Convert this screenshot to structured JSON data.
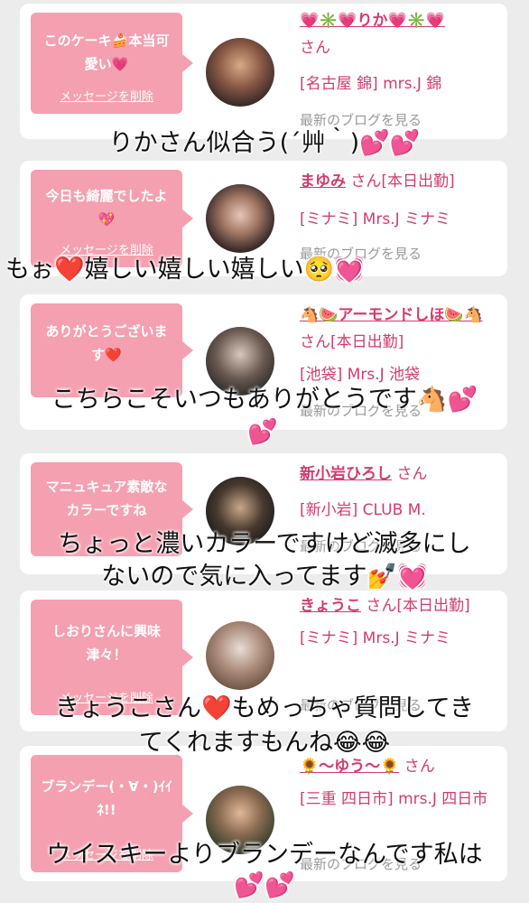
{
  "cards": [
    {
      "message": "このケーキ🍰本当可愛い💗",
      "delete_label": "メッセージを削除",
      "name": "💗✳️💗りか💗✳️💗",
      "san": "さん",
      "location": "[名古屋 錦] mrs.J 錦",
      "blog": "最新のブログを見る"
    },
    {
      "message": "今日も綺麗でしたよ💖",
      "delete_label": "メッセージを削除",
      "name": "まゆみ",
      "san": "さん[本日出勤]",
      "location": "[ミナミ] Mrs.J ミナミ",
      "blog": "最新のブログを見る"
    },
    {
      "message": "ありがとうございます❤️",
      "delete_label": "メッセージを削除",
      "name": "🐴🍉アーモンドしほ🍉🐴",
      "san": "さん[本日出勤]",
      "location": "[池袋] Mrs.J 池袋",
      "blog": "最新のブログを見る"
    },
    {
      "message": "マニュキュア素敵なカラーですね",
      "delete_label": "メッセージを削除",
      "name": "新小岩ひろし",
      "san": "さん",
      "location": "[新小岩] CLUB M.",
      "blog": "最新のブログを見る"
    },
    {
      "message": "しおりさんに興味津々！",
      "delete_label": "メッセージを削除",
      "name": "きょうこ",
      "san": "さん[本日出勤]",
      "location": "[ミナミ] Mrs.J ミナミ",
      "blog": "最新のブログを見る"
    },
    {
      "message": "ブランデー(・∀・)ｲｲﾈ!!",
      "delete_label": "メッセージを削除",
      "name": "🌻〜ゆう〜🌻",
      "san": "さん",
      "location": "[三重 四日市] mrs.J 四日市",
      "blog": "最新のブログを見る"
    }
  ],
  "overlays": [
    "りかさん似合う(´艸｀)💕💕",
    "もぉ❤️嬉しい嬉しい嬉しい🥺💓",
    "こちらこそいつもありがとうです🐴💕",
    "💕",
    "ちょっと濃いカラーですけど滅多にし",
    "ないので気に入ってます💅💓",
    "きょうこさん❤️もめっちゃ質問してき",
    "てくれますもんね😂😂",
    "ウイスキーよりブランデーなんです私は",
    "💕💕"
  ]
}
